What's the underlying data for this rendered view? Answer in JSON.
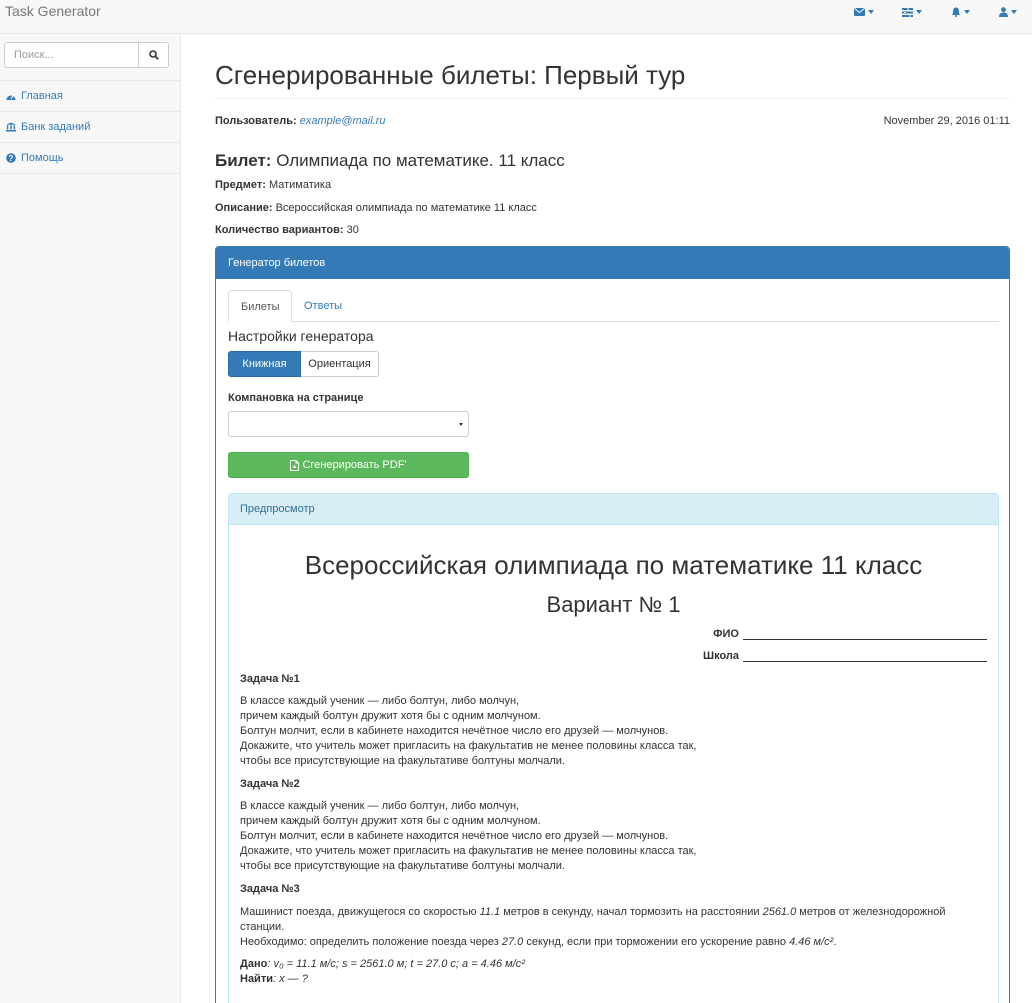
{
  "navbar": {
    "brand": "Task Generator",
    "icons": [
      "envelope-icon",
      "tasks-icon",
      "bell-icon",
      "user-icon"
    ]
  },
  "sidebar": {
    "search_placeholder": "Поиск...",
    "items": [
      {
        "label": "Главная",
        "icon": "dashboard-icon"
      },
      {
        "label": "Банк заданий",
        "icon": "bank-icon"
      },
      {
        "label": "Помощь",
        "icon": "question-icon"
      }
    ]
  },
  "main": {
    "title": "Сгенерированные билеты: Первый тур",
    "user_label": "Пользователь:",
    "user_value": "example@mail.ru",
    "date": "November 29, 2016 01:11",
    "ticket_label": "Билет:",
    "ticket_value": "Олимпиада по математике. 11 класс",
    "subject_label": "Предмет:",
    "subject_value": "Матиматика",
    "description_label": "Описание:",
    "description_value": "Всероссийская олимпиада по математике 11 класс",
    "variants_label": "Количество вариантов:",
    "variants_value": "30"
  },
  "panel": {
    "title": "Генератор билетов",
    "tabs": [
      "Билеты",
      "Ответы"
    ],
    "settings_title": "Настройки генератора",
    "orientation_active": "Книжная",
    "orientation_other": "Ориентация",
    "layout_label": "Компановка на странице",
    "layout_selected": "",
    "generate_label": "Сгенерировать PDF'"
  },
  "preview": {
    "title": "Предпросмотр",
    "doc_title": "Всероссийская олимпиада по математике 11 класс",
    "variant": "Вариант № 1",
    "fio_label": "ФИО",
    "school_label": "Школа",
    "tasks": [
      {
        "heading": "Задача №1",
        "lines": [
          "В классе каждый ученик — либо болтун, либо молчун,",
          "причем каждый болтун дружит хотя бы с одним молчуном.",
          "Болтун молчит, если в кабинете находится нечётное число его друзей — молчунов.",
          "Докажите, что учитель может пригласить на факультатив не менее половины класса так,",
          "чтобы все присутствующие на факультативе болтуны молчали."
        ]
      },
      {
        "heading": "Задача №2",
        "lines": [
          "В классе каждый ученик — либо болтун, либо молчун,",
          "причем каждый болтун дружит хотя бы с одним молчуном.",
          "Болтун молчит, если в кабинете находится нечётное число его друзей — молчунов.",
          "Докажите, что учитель может пригласить на факультатив не менее половины класса так,",
          "чтобы все присутствующие на факультативе болтуны молчали."
        ]
      },
      {
        "heading": "Задача №3",
        "p1_a": "Машинист поезда, движущегося со скоростью ",
        "p1_speed": "11.1",
        "p1_b": " метров в секунду, начал тормозить на расстоянии ",
        "p1_dist": "2561.0",
        "p1_c": " метров от железнодорожной",
        "p1_d": "станции.",
        "p2_a": "Необходимо: определить положение поезда через ",
        "p2_time": "27.0",
        "p2_b": " секунд, если при торможении его ускорение равно ",
        "p2_acc": "4.46 м/с²",
        "p2_c": ".",
        "given_label": "Дано",
        "given_value": ": v₀ = 11.1 м/с; s = 2561.0 м; t = 27.0 с; a = 4.46 м/с²",
        "find_label": "Найти",
        "find_value": ": x — ?"
      }
    ]
  }
}
